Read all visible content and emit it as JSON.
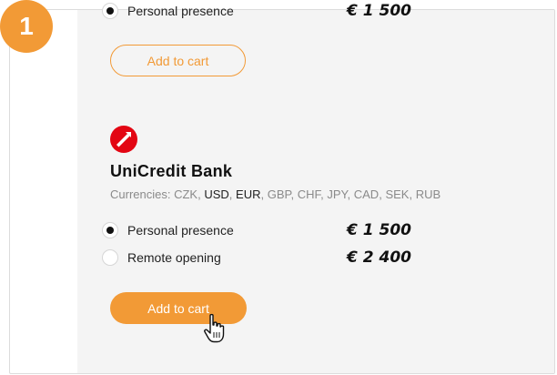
{
  "step": {
    "number": "1"
  },
  "previous_offer": {
    "option_label": "Personal presence",
    "option_price": "€ 1 500",
    "add_to_cart_label": "Add to cart"
  },
  "bank": {
    "logo_icon": "unicredit-logo-icon",
    "name": "UniCredit Bank",
    "currencies_prefix": "Currencies:",
    "currencies": [
      {
        "code": "CZK",
        "available": false
      },
      {
        "code": "USD",
        "available": true
      },
      {
        "code": "EUR",
        "available": true
      },
      {
        "code": "GBP",
        "available": false
      },
      {
        "code": "CHF",
        "available": false
      },
      {
        "code": "JPY",
        "available": false
      },
      {
        "code": "CAD",
        "available": false
      },
      {
        "code": "SEK",
        "available": false
      },
      {
        "code": "RUB",
        "available": false
      }
    ],
    "options": [
      {
        "label": "Personal presence",
        "price": "€ 1 500",
        "selected": true
      },
      {
        "label": "Remote opening",
        "price": "€ 2 400",
        "selected": false
      }
    ],
    "add_to_cart_label": "Add to cart"
  },
  "colors": {
    "accent": "#f29a36",
    "logo_red": "#e30613",
    "panel_bg": "#f4f4f4"
  },
  "cursor_icon": "hand-pointer-icon"
}
